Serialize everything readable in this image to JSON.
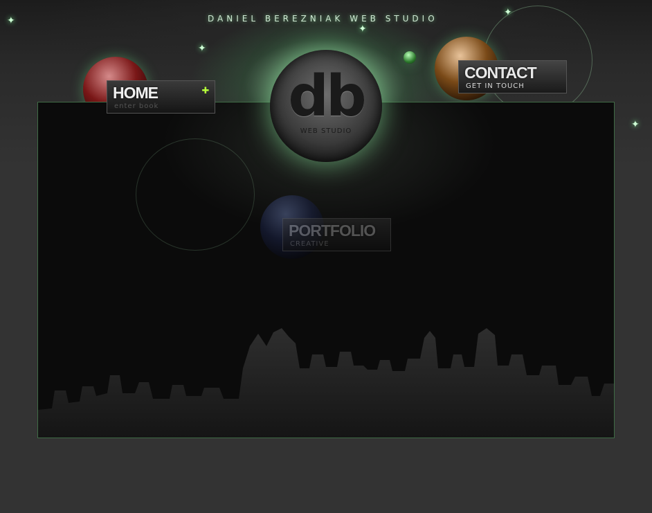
{
  "header": {
    "studio_name": "DANIEL BEREZNIAK WEB STUDIO"
  },
  "logo": {
    "mark": "db",
    "subtitle": "WEB STUDIO"
  },
  "nav": {
    "home": {
      "title": "HOME",
      "subtitle": "enter book"
    },
    "contact": {
      "title": "CONTACT",
      "subtitle": "GET IN TOUCH"
    },
    "portfolio": {
      "title": "PORTFOLIO",
      "subtitle": "CREATIVE"
    }
  },
  "icons": {
    "home_arrow": "plus-arrow-icon",
    "sparkle": "sparkle-icon"
  },
  "colors": {
    "background": "#333333",
    "panel": "#0b0b0b",
    "panel_border": "#3f6b45",
    "accent_glow": "#7cff9a",
    "home_icon": "#b6ff3a"
  }
}
